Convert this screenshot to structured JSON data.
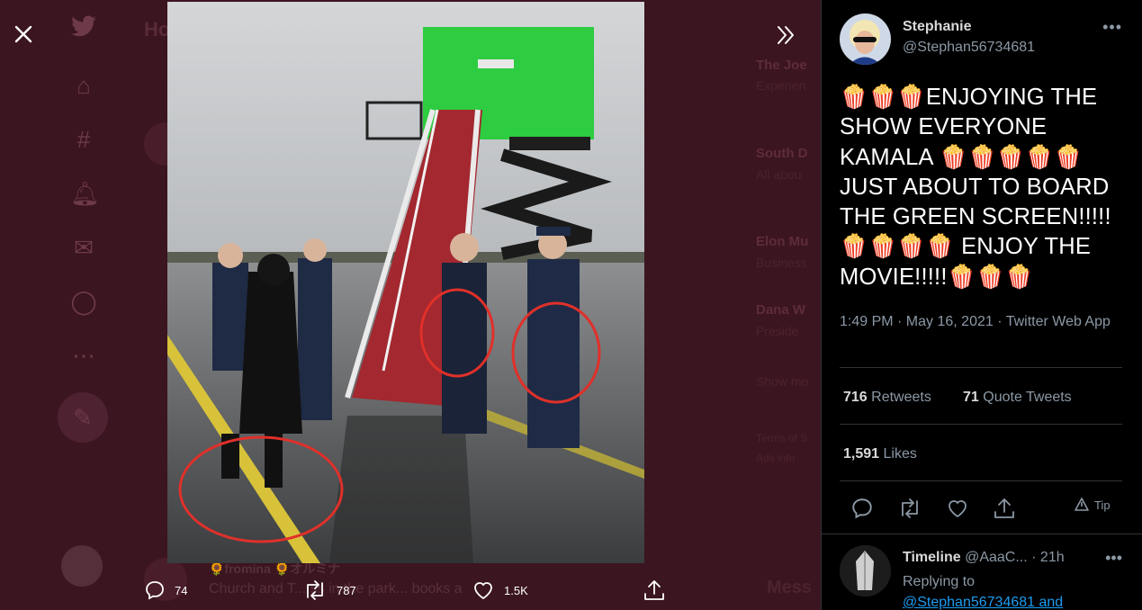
{
  "background": {
    "header": "Ho",
    "trends": [
      {
        "title": "The Joe",
        "sub": "Experien"
      },
      {
        "title": "South D",
        "sub": "All abou"
      },
      {
        "title": "Elon Mu",
        "sub": "Business"
      },
      {
        "title": "Dana W",
        "sub": "Preside"
      }
    ],
    "show_more": "Show mo",
    "terms": "Terms of S",
    "ads": "Ads info",
    "messages": "Mess",
    "feed_name": "🌻fromina 🌻オルミナ",
    "feed_text": "Church and T... ss in the park... books a"
  },
  "media": {
    "actions": {
      "reply_count": "74",
      "retweet_count": "787",
      "like_count": "1.5K"
    }
  },
  "tweet": {
    "author_name": "Stephanie",
    "author_handle": "@Stephan56734681",
    "text": "🍿🍿🍿ENJOYING THE SHOW EVERYONE KAMALA 🍿🍿🍿🍿🍿 JUST ABOUT TO BOARD THE GREEN SCREEN!!!!!🍿🍿🍿🍿 ENJOY THE MOVIE!!!!!🍿🍿🍿",
    "meta": "1:49 PM · May 16, 2021 · Twitter Web App",
    "retweets_count": "716",
    "retweets_label": "Retweets",
    "quote_count": "71",
    "quote_label": "Quote Tweets",
    "likes_count": "1,591",
    "likes_label": "Likes",
    "tip_label": "Tip"
  },
  "reply": {
    "name": "Timeline",
    "handle": "@AaaC...",
    "time": "· 21h",
    "replying_to": "Replying to",
    "replying_link": "@Stephan56734681 and"
  },
  "colors": {
    "accent": "#1d9bf0",
    "overlay": "#3b1520",
    "green_screen": "#2ecc40",
    "carpet": "#a3282f"
  }
}
